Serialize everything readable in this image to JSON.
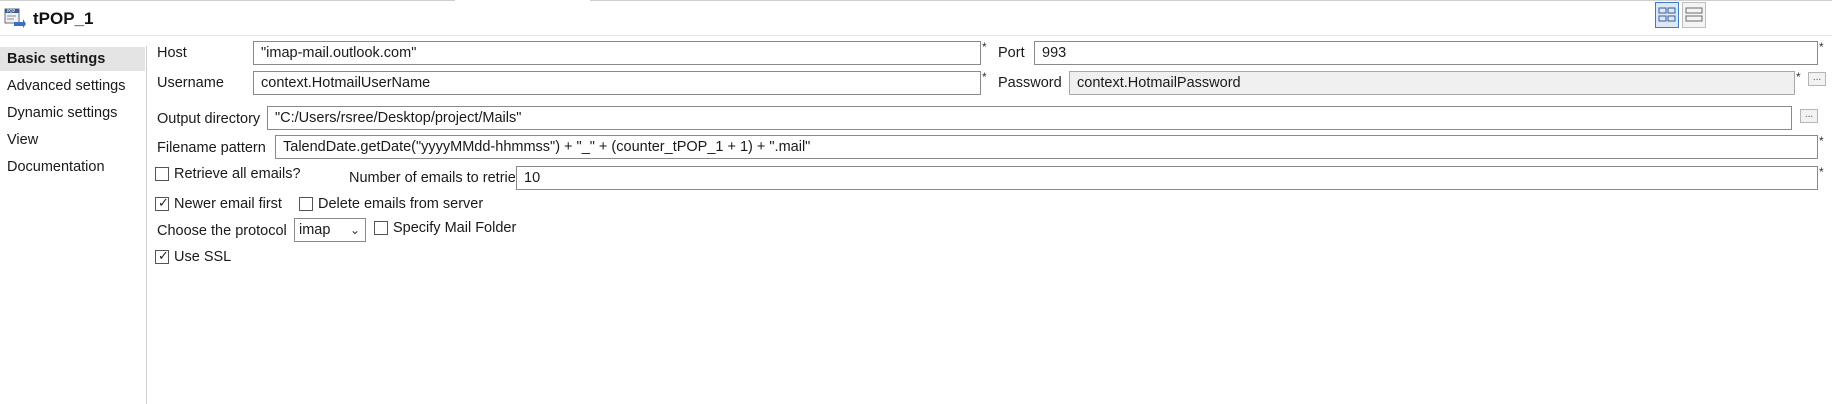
{
  "header": {
    "title": "tPOP_1",
    "icon": "pop-component-icon",
    "view_buttons": [
      {
        "name": "grid-view-icon",
        "active": true
      },
      {
        "name": "list-view-icon",
        "active": false
      }
    ]
  },
  "sidebar": {
    "items": [
      {
        "label": "Basic settings",
        "active": true
      },
      {
        "label": "Advanced settings",
        "active": false
      },
      {
        "label": "Dynamic settings",
        "active": false
      },
      {
        "label": "View",
        "active": false
      },
      {
        "label": "Documentation",
        "active": false
      }
    ]
  },
  "form": {
    "host_label": "Host",
    "host_value": "\"imap-mail.outlook.com\"",
    "port_label": "Port",
    "port_value": "993",
    "username_label": "Username",
    "username_value": "context.HotmailUserName",
    "password_label": "Password",
    "password_value": "context.HotmailPassword",
    "output_dir_label": "Output directory",
    "output_dir_value": "\"C:/Users/rsree/Desktop/project/Mails\"",
    "filename_label": "Filename pattern",
    "filename_value": "TalendDate.getDate(\"yyyyMMdd-hhmmss\") + \"_\" + (counter_tPOP_1 + 1) + \".mail\"",
    "retrieve_all_label": "Retrieve all emails?",
    "retrieve_all_checked": false,
    "num_emails_label": "Number of emails to retrieve",
    "num_emails_value": "10",
    "newer_first_label": "Newer email first",
    "newer_first_checked": true,
    "delete_label": "Delete emails from server",
    "delete_checked": false,
    "protocol_label": "Choose the protocol",
    "protocol_value": "imap",
    "specify_folder_label": "Specify Mail Folder",
    "specify_folder_checked": false,
    "use_ssl_label": "Use SSL",
    "use_ssl_checked": true,
    "required_mark": "*",
    "browse_label": "..."
  }
}
